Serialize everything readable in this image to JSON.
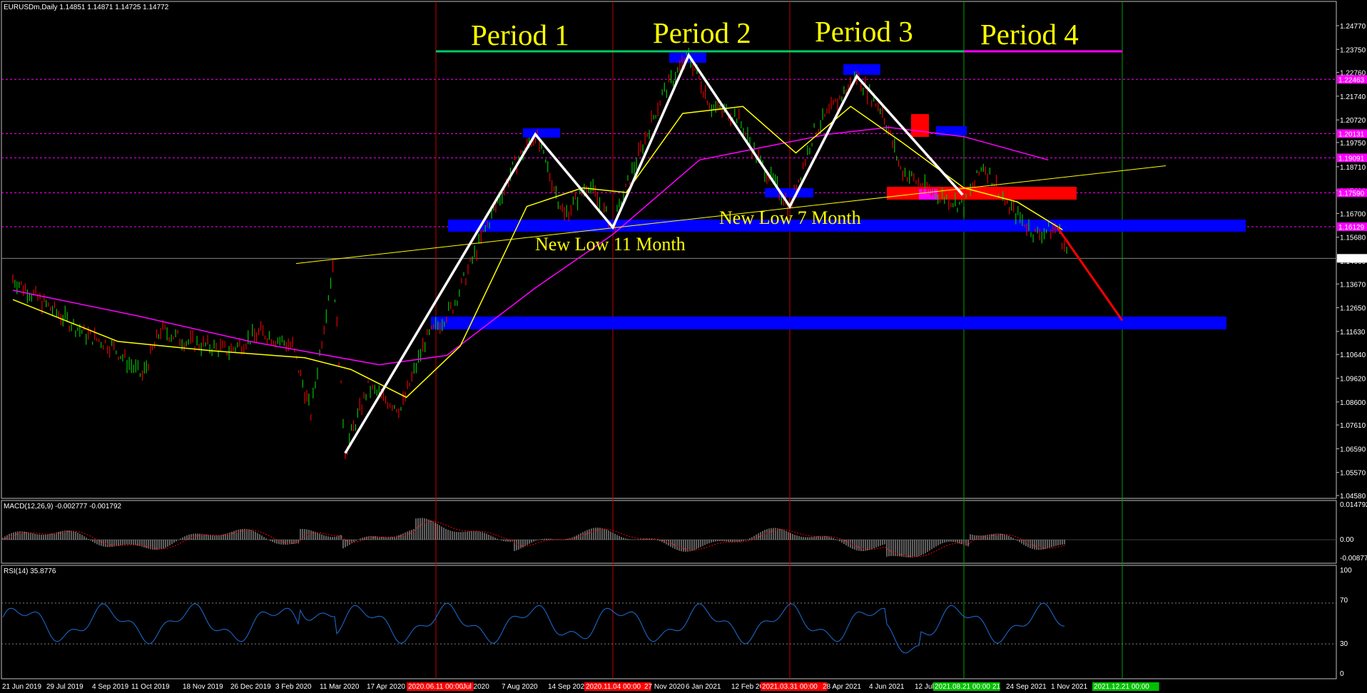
{
  "main": {
    "info": "EURUSDm,Daily  1.14851 1.14871 1.14725 1.14772",
    "periods": [
      "Period 1",
      "Period 2",
      "Period 3",
      "Period 4"
    ],
    "annotations": [
      "New Low 11 Month",
      "New Low 7 Month"
    ],
    "price_ticks": [
      "1.24770",
      "1.23750",
      "1.22760",
      "1.21740",
      "1.20720",
      "1.19750",
      "1.18710",
      "1.17690",
      "1.16700",
      "1.15680",
      "1.14660",
      "1.13670",
      "1.12650",
      "1.11630",
      "1.10640",
      "1.09620",
      "1.08600",
      "1.07610",
      "1.06590",
      "1.05570",
      "1.04580"
    ],
    "level_tags": [
      "1.22463",
      "1.20131",
      "1.19091",
      "1.17590",
      "1.16129",
      "1.14772"
    ],
    "colors": {
      "bg": "#000000",
      "axis": "#c0c0c0",
      "period_line": "#00cc66",
      "period4_line": "#ff00ff",
      "yellow": "#ffff00",
      "magenta": "#ff00ff",
      "blue": "#0000ff",
      "red": "#ff0000",
      "vline_red": "#c00000",
      "vline_green": "#00a000",
      "rsi": "#1e6fd9",
      "macd_hist": "#c0c0c0",
      "macd_signal": "#ff0000"
    }
  },
  "macd": {
    "title": "MACD(12,26,9) -0.002777 -0.001792",
    "ticks": [
      "0.014792",
      "0.00",
      "-0.008775"
    ]
  },
  "rsi": {
    "title": "RSI(14) 35.8776",
    "ticks": [
      "100",
      "70",
      "30",
      "0"
    ]
  },
  "dates": [
    "21 Jun 2019",
    "29 Jul 2019",
    "4 Sep 2019",
    "11 Oct 2019",
    "18 Nov 2019",
    "26 Dec 2019",
    "3 Feb 2020",
    "11 Mar 2020",
    "17 Apr 2020",
    "2020.06.11 00:00",
    "Jul 2020",
    "7 Aug 2020",
    "14 Sep 2020",
    "2020.11.04 00:00",
    "27 Nov 2020",
    "6 Jan 2021",
    "12 Feb 2021",
    "2021.03.31 00:00",
    "28 Apr 2021",
    "4 Jun 2021",
    "12 Jul",
    "2021.08.21 00:00",
    "21",
    "24 Sep 2021",
    "1 Nov 2021",
    "2021.12.21 00:00"
  ],
  "chart_data": {
    "type": "line",
    "symbol": "EURUSDm",
    "timeframe": "Daily",
    "ohlc_last": {
      "open": 1.14851,
      "high": 1.14871,
      "low": 1.14725,
      "close": 1.14772
    },
    "ylim": [
      1.0458,
      1.2477
    ],
    "x": [
      "21 Jun 2019",
      "29 Jul 2019",
      "4 Sep 2019",
      "11 Oct 2019",
      "18 Nov 2019",
      "26 Dec 2019",
      "3 Feb 2020",
      "11 Mar 2020",
      "17 Apr 2020",
      "Jul 2020",
      "7 Aug 2020",
      "14 Sep 2020",
      "27 Nov 2020",
      "6 Jan 2021",
      "12 Feb 2021",
      "28 Apr 2021",
      "4 Jun 2021",
      "12 Jul",
      "24 Sep 2021",
      "1 Nov 2021"
    ],
    "price_series": [
      {
        "values": [
          1.139,
          1.121,
          1.1,
          1.101,
          1.105,
          1.113,
          1.097,
          1.12,
          1.083,
          1.143,
          1.182,
          1.168,
          1.197,
          1.231,
          1.215,
          1.21,
          1.221,
          1.17,
          1.166,
          1.158
        ]
      }
    ],
    "zigzag": [
      {
        "date": "20 Mar 2020",
        "price": 1.064
      },
      {
        "date": "1 Sep 2020",
        "price": 1.201
      },
      {
        "date": "4 Nov 2020",
        "price": 1.161
      },
      {
        "date": "6 Jan 2021",
        "price": 1.235
      },
      {
        "date": "31 Mar 2021",
        "price": 1.17
      },
      {
        "date": "25 May 2021",
        "price": 1.226
      },
      {
        "date": "20 Aug 2021",
        "price": 1.175
      }
    ],
    "projection": [
      {
        "date": "1 Nov 2021",
        "price": 1.161
      },
      {
        "date": "21 Dec 2021",
        "price": 1.121
      }
    ],
    "horizontal_levels": [
      1.22463,
      1.20131,
      1.19091,
      1.1759,
      1.16129
    ],
    "current_price": 1.14772,
    "period_boundaries": [
      "2020.06.11 00:00",
      "2020.11.04 00:00",
      "2021.03.31 00:00",
      "2021.08.21 00:00",
      "2021.12.21 00:00"
    ],
    "macd": {
      "params": "12,26,9",
      "main": -0.002777,
      "signal": -0.001792,
      "ylim": [
        -0.008775,
        0.014792
      ]
    },
    "rsi": {
      "period": 14,
      "value": 35.8776,
      "levels": [
        70,
        30
      ],
      "ylim": [
        0,
        100
      ]
    }
  }
}
